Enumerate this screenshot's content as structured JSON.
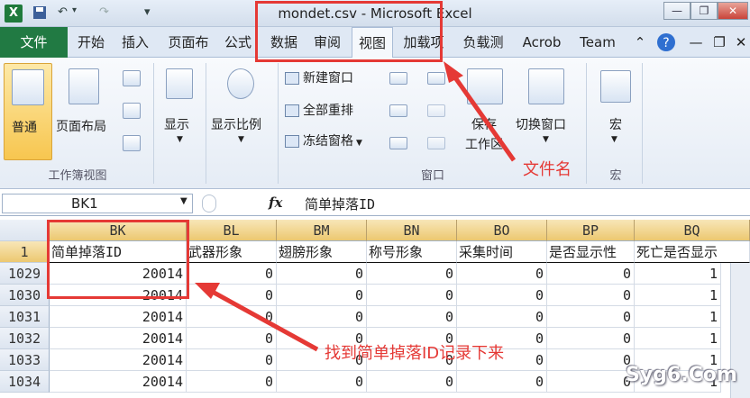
{
  "window": {
    "title": "mondet.csv - Microsoft Excel",
    "minimize": "—",
    "restore": "❐",
    "close": "✕"
  },
  "quick_access": {
    "undo": "↶",
    "redo": "↷",
    "dropdown": "▾"
  },
  "tabs": {
    "file": "文件",
    "items": [
      "开始",
      "插入",
      "页面布",
      "公式",
      "数据",
      "审阅",
      "视图",
      "加载项",
      "负载测",
      "Acrob",
      "Team"
    ],
    "active_index": 6
  },
  "ribbon": {
    "normal": "普通",
    "page_layout": "页面布局",
    "group_workbook_views": "工作簿视图",
    "show": "显示",
    "zoom": "显示比例",
    "new_window": "新建窗口",
    "arrange_all": "全部重排",
    "freeze_panes": "冻结窗格",
    "save_workspace": "保存\n工作区",
    "switch_windows": "切换窗口",
    "group_window": "窗口",
    "macros": "宏",
    "group_macros": "宏"
  },
  "formula_bar": {
    "name_box": "BK1",
    "fx": "fx",
    "content": "简单掉落ID"
  },
  "columns": [
    "BK",
    "BL",
    "BM",
    "BN",
    "BO",
    "BP",
    "BQ"
  ],
  "header_row": {
    "row": "1",
    "cells": [
      "简单掉落ID",
      "武器形象",
      "翅膀形象",
      "称号形象",
      "采集时间",
      "是否显示性",
      "死亡是否显示"
    ]
  },
  "rows": [
    {
      "row": "1029",
      "cells": [
        "20014",
        "0",
        "0",
        "0",
        "0",
        "0",
        "1"
      ]
    },
    {
      "row": "1030",
      "cells": [
        "20014",
        "0",
        "0",
        "0",
        "0",
        "0",
        "1"
      ]
    },
    {
      "row": "1031",
      "cells": [
        "20014",
        "0",
        "0",
        "0",
        "0",
        "0",
        "1"
      ]
    },
    {
      "row": "1032",
      "cells": [
        "20014",
        "0",
        "0",
        "0",
        "0",
        "0",
        "1"
      ]
    },
    {
      "row": "1033",
      "cells": [
        "20014",
        "0",
        "0",
        "0",
        "0",
        "0",
        "1"
      ]
    },
    {
      "row": "1034",
      "cells": [
        "20014",
        "0",
        "0",
        "0",
        "0",
        "0",
        "1"
      ]
    }
  ],
  "annotations": {
    "filename": "文件名",
    "find_id": "找到简单掉落ID记录下来"
  },
  "watermark": "Syg6.Com",
  "colors": {
    "annotation": "#e53935",
    "file_tab": "#217a43",
    "column_header": "#ecc870"
  }
}
